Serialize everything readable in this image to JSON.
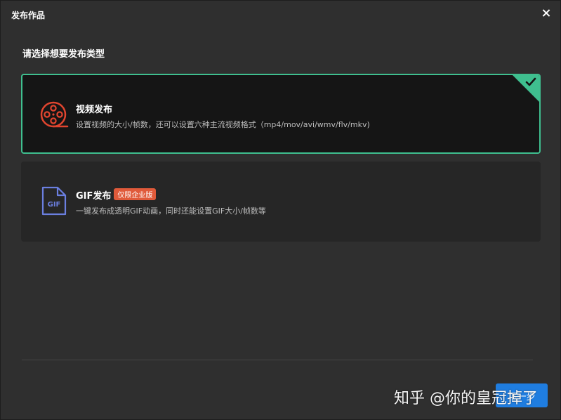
{
  "dialog": {
    "title": "发布作品",
    "prompt": "请选择想要发布类型"
  },
  "options": [
    {
      "name": "视频发布",
      "desc": "设置视频的大小/帧数，还可以设置六种主流视频格式（mp4/mov/avi/wmv/flv/mkv)",
      "icon": "film-reel-icon",
      "selected": true
    },
    {
      "name": "GIF发布",
      "badge": "仅限企业版",
      "desc": "一键发布成透明GIF动画，同时还能设置GIF大小/帧数等",
      "icon": "gif-file-icon",
      "icon_text": "GIF",
      "selected": false
    }
  ],
  "footer": {
    "next_label": "下一步",
    "watermark": "知乎 @你的皇冠掉了"
  },
  "colors": {
    "accent": "#3fbf8f",
    "button": "#1f7de0",
    "video_icon": "#e0452f",
    "gif_icon": "#6b7fe0",
    "badge": "#e05a3a"
  }
}
